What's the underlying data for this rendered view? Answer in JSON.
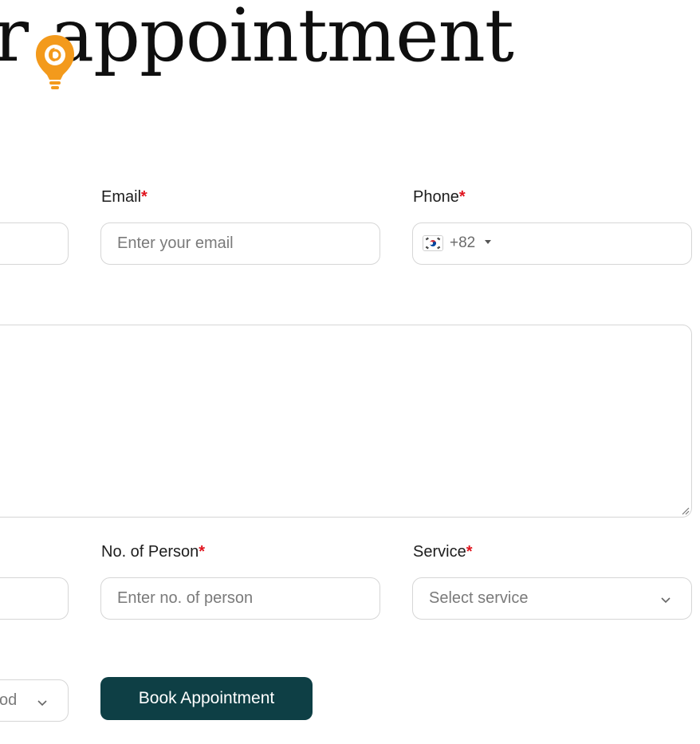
{
  "header": {
    "title_tail": "r appointment"
  },
  "form": {
    "email": {
      "label": "Email",
      "required_mark": "*",
      "placeholder": "Enter your email"
    },
    "phone": {
      "label": "Phone",
      "required_mark": "*",
      "dial_code": "+82",
      "country_flag": "south-korea-flag-icon"
    },
    "persons": {
      "label": "No. of Person",
      "required_mark": "*",
      "placeholder": "Enter no. of person"
    },
    "service": {
      "label": "Service",
      "required_mark": "*",
      "selected": "Select service"
    },
    "partial_select": {
      "visible_text": "od"
    },
    "submit_label": "Book Appointment"
  },
  "colors": {
    "accent_button": "#0e3f45",
    "required": "#e0141e",
    "pin_orange": "#f39a1c"
  }
}
